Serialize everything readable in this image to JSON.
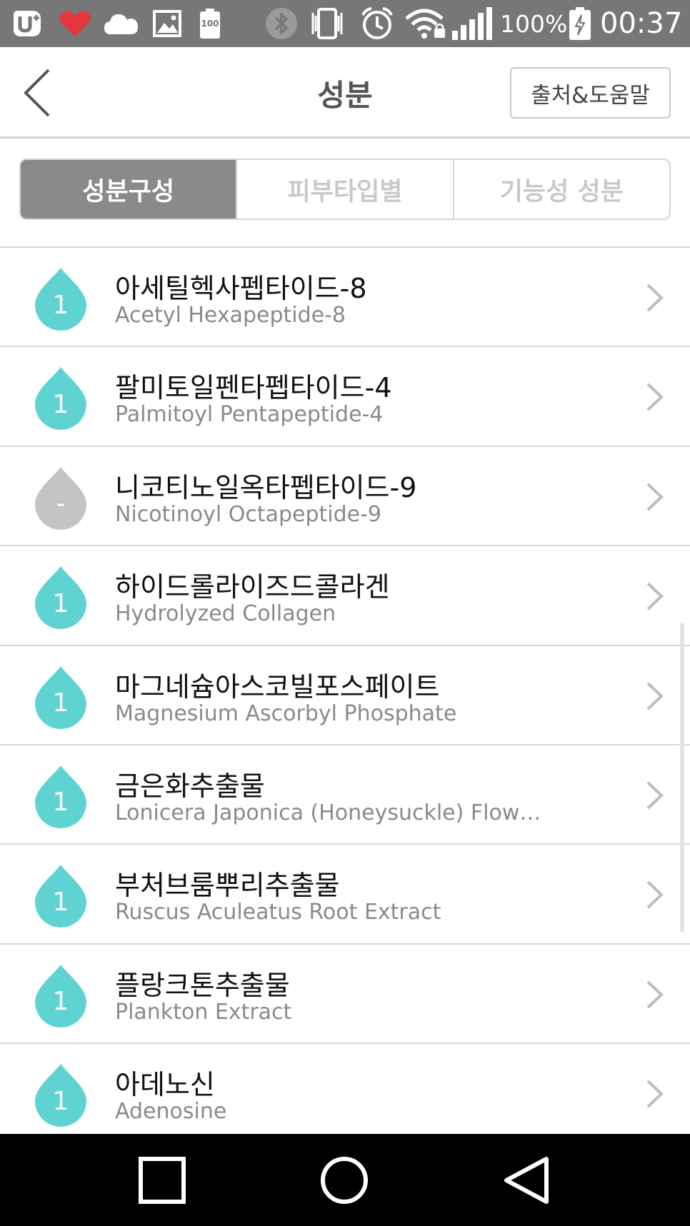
{
  "status_bar": {
    "battery_percent": "100%",
    "time": "00:37",
    "battery_badge": "100",
    "icons": [
      "uplus-logo-icon",
      "heart-icon",
      "cloud-icon",
      "image-icon",
      "battery-saver-icon",
      "bluetooth-icon",
      "vibrate-icon",
      "alarm-icon",
      "wifi-lock-icon",
      "signal-icon",
      "battery-charging-icon"
    ]
  },
  "header": {
    "title": "성분",
    "source_button": "출처&도움말",
    "back_icon": "back-chevron-icon"
  },
  "tabs": [
    {
      "label": "성분구성",
      "active": true
    },
    {
      "label": "피부타입별",
      "active": false
    },
    {
      "label": "기능성 성분",
      "active": false
    }
  ],
  "colors": {
    "drop_teal": "#5fd3d1",
    "drop_gray": "#c4c4c4",
    "tab_active": "#8a8a8a",
    "statusbar": "#777777"
  },
  "ingredients": [
    {
      "ko": "아세틸헥사펩타이드-8",
      "en": "Acetyl Hexapeptide-8",
      "grade": "1",
      "color": "teal"
    },
    {
      "ko": "팔미토일펜타펩타이드-4",
      "en": "Palmitoyl Pentapeptide-4",
      "grade": "1",
      "color": "teal"
    },
    {
      "ko": "니코티노일옥타펩타이드-9",
      "en": "Nicotinoyl Octapeptide-9",
      "grade": "-",
      "color": "gray"
    },
    {
      "ko": "하이드롤라이즈드콜라겐",
      "en": "Hydrolyzed Collagen",
      "grade": "1",
      "color": "teal"
    },
    {
      "ko": "마그네슘아스코빌포스페이트",
      "en": "Magnesium Ascorbyl Phosphate",
      "grade": "1",
      "color": "teal"
    },
    {
      "ko": "금은화추출물",
      "en": "Lonicera Japonica (Honeysuckle) Flower…",
      "grade": "1",
      "color": "teal"
    },
    {
      "ko": "부처브룸뿌리추출물",
      "en": "Ruscus Aculeatus Root Extract",
      "grade": "1",
      "color": "teal"
    },
    {
      "ko": "플랑크톤추출물",
      "en": "Plankton Extract",
      "grade": "1",
      "color": "teal"
    },
    {
      "ko": "아데노신",
      "en": "Adenosine",
      "grade": "1",
      "color": "teal"
    }
  ],
  "nav_bar": {
    "buttons": [
      "recent-apps-icon",
      "home-icon",
      "back-triangle-icon"
    ]
  }
}
